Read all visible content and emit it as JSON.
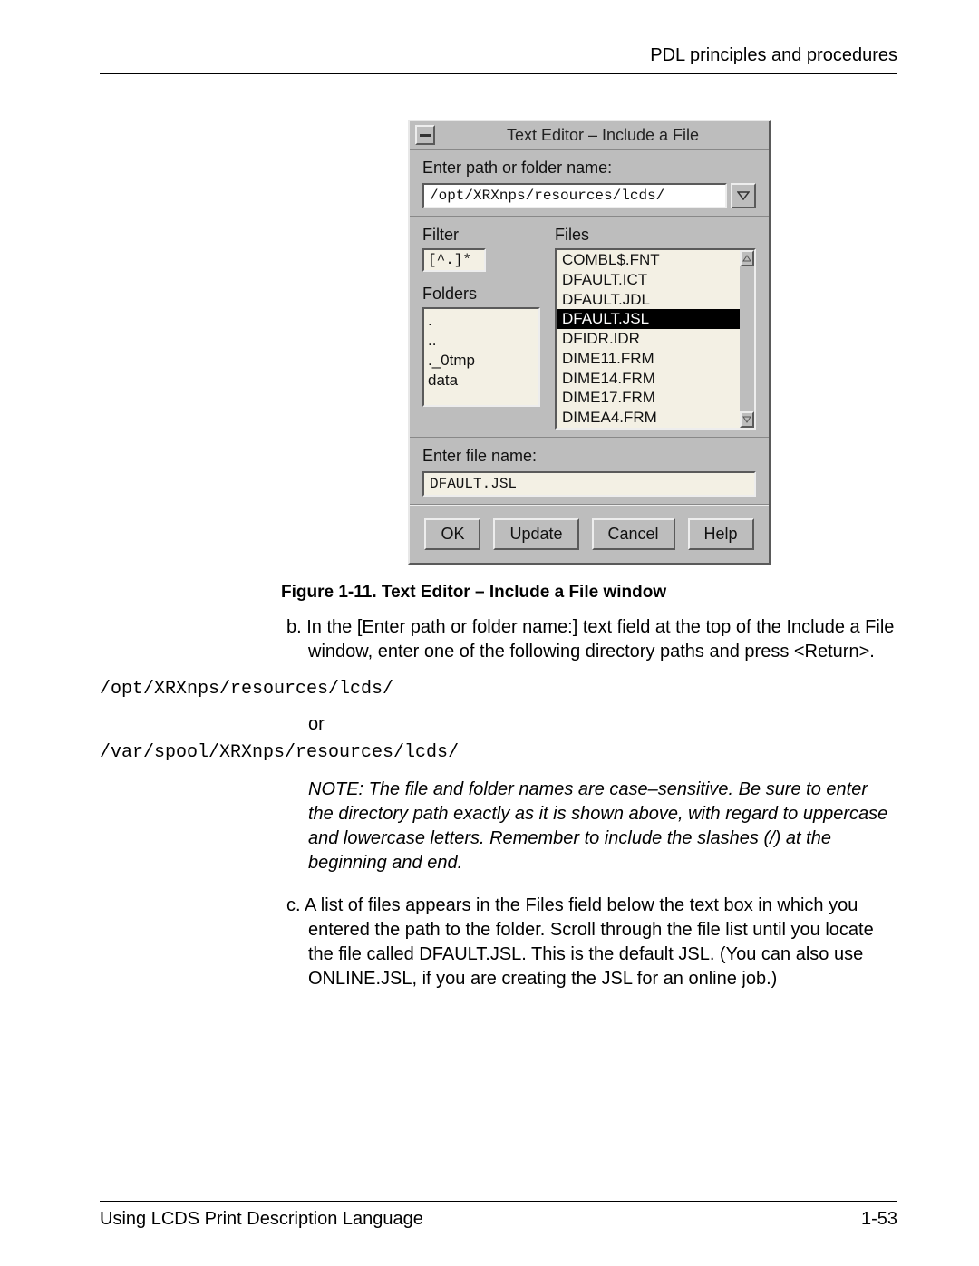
{
  "header": "PDL principles and procedures",
  "dialog": {
    "title": "Text Editor – Include a File",
    "pathLabel": "Enter path or folder name:",
    "pathValue": "/opt/XRXnps/resources/lcds/",
    "filterLabel": "Filter",
    "filterValue": "[^.]*",
    "foldersLabel": "Folders",
    "folders": [
      ".",
      "..",
      "._0tmp",
      "data"
    ],
    "filesLabel": "Files",
    "files": [
      "COMBL$.FNT",
      "DFAULT.ICT",
      "DFAULT.JDL",
      "DFAULT.JSL",
      "DFIDR.IDR",
      "DIME11.FRM",
      "DIME14.FRM",
      "DIME17.FRM",
      "DIMEA4.FRM"
    ],
    "selectedFile": "DFAULT.JSL",
    "filenameLabel": "Enter file name:",
    "filenameValue": "DFAULT.JSL",
    "buttons": {
      "ok": "OK",
      "update": "Update",
      "cancel": "Cancel",
      "help": "Help"
    }
  },
  "caption": "Figure 1-11.  Text Editor – Include a File window",
  "stepB": "b.  In the [Enter path or folder name:] text field at the top of the Include a File window, enter one of the following directory paths and press <Return>.",
  "path1": "/opt/XRXnps/resources/lcds/",
  "or": "or",
  "path2": "/var/spool/XRXnps/resources/lcds/",
  "note": "NOTE:  The file and folder names are case–sensitive. Be sure to enter the directory path exactly as it is shown above, with regard to uppercase and lowercase letters. Remember to include the slashes (/) at the beginning and end.",
  "stepC": "c.  A list of files appears in the Files field below the text box in which you entered the path to the folder. Scroll through the file list until you locate the file called DFAULT.JSL. This is the default JSL. (You can also use ONLINE.JSL, if you are creating the JSL for an online job.)",
  "footer": {
    "left": "Using LCDS Print Description Language",
    "right": "1-53"
  }
}
